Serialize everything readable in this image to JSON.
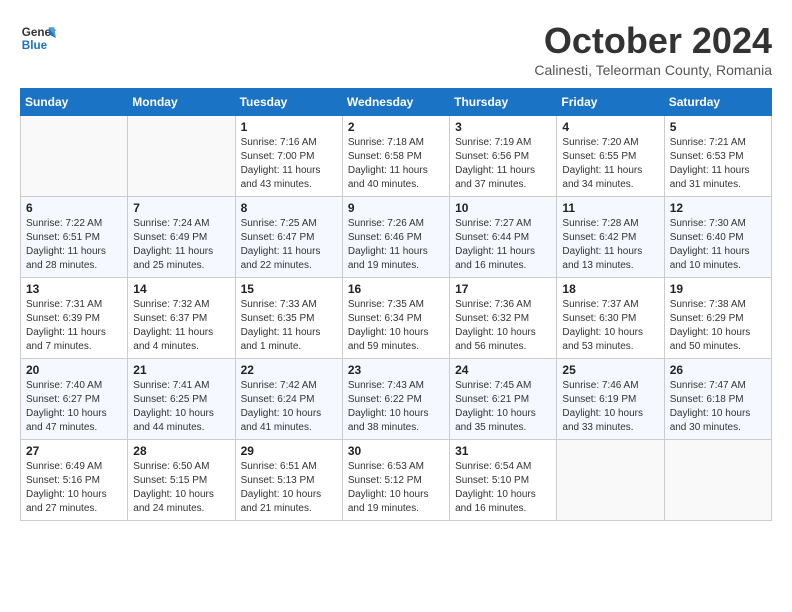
{
  "header": {
    "logo_line1": "General",
    "logo_line2": "Blue",
    "month": "October 2024",
    "location": "Calinesti, Teleorman County, Romania"
  },
  "weekdays": [
    "Sunday",
    "Monday",
    "Tuesday",
    "Wednesday",
    "Thursday",
    "Friday",
    "Saturday"
  ],
  "weeks": [
    [
      {
        "num": "",
        "info": ""
      },
      {
        "num": "",
        "info": ""
      },
      {
        "num": "1",
        "info": "Sunrise: 7:16 AM\nSunset: 7:00 PM\nDaylight: 11 hours\nand 43 minutes."
      },
      {
        "num": "2",
        "info": "Sunrise: 7:18 AM\nSunset: 6:58 PM\nDaylight: 11 hours\nand 40 minutes."
      },
      {
        "num": "3",
        "info": "Sunrise: 7:19 AM\nSunset: 6:56 PM\nDaylight: 11 hours\nand 37 minutes."
      },
      {
        "num": "4",
        "info": "Sunrise: 7:20 AM\nSunset: 6:55 PM\nDaylight: 11 hours\nand 34 minutes."
      },
      {
        "num": "5",
        "info": "Sunrise: 7:21 AM\nSunset: 6:53 PM\nDaylight: 11 hours\nand 31 minutes."
      }
    ],
    [
      {
        "num": "6",
        "info": "Sunrise: 7:22 AM\nSunset: 6:51 PM\nDaylight: 11 hours\nand 28 minutes."
      },
      {
        "num": "7",
        "info": "Sunrise: 7:24 AM\nSunset: 6:49 PM\nDaylight: 11 hours\nand 25 minutes."
      },
      {
        "num": "8",
        "info": "Sunrise: 7:25 AM\nSunset: 6:47 PM\nDaylight: 11 hours\nand 22 minutes."
      },
      {
        "num": "9",
        "info": "Sunrise: 7:26 AM\nSunset: 6:46 PM\nDaylight: 11 hours\nand 19 minutes."
      },
      {
        "num": "10",
        "info": "Sunrise: 7:27 AM\nSunset: 6:44 PM\nDaylight: 11 hours\nand 16 minutes."
      },
      {
        "num": "11",
        "info": "Sunrise: 7:28 AM\nSunset: 6:42 PM\nDaylight: 11 hours\nand 13 minutes."
      },
      {
        "num": "12",
        "info": "Sunrise: 7:30 AM\nSunset: 6:40 PM\nDaylight: 11 hours\nand 10 minutes."
      }
    ],
    [
      {
        "num": "13",
        "info": "Sunrise: 7:31 AM\nSunset: 6:39 PM\nDaylight: 11 hours\nand 7 minutes."
      },
      {
        "num": "14",
        "info": "Sunrise: 7:32 AM\nSunset: 6:37 PM\nDaylight: 11 hours\nand 4 minutes."
      },
      {
        "num": "15",
        "info": "Sunrise: 7:33 AM\nSunset: 6:35 PM\nDaylight: 11 hours\nand 1 minute."
      },
      {
        "num": "16",
        "info": "Sunrise: 7:35 AM\nSunset: 6:34 PM\nDaylight: 10 hours\nand 59 minutes."
      },
      {
        "num": "17",
        "info": "Sunrise: 7:36 AM\nSunset: 6:32 PM\nDaylight: 10 hours\nand 56 minutes."
      },
      {
        "num": "18",
        "info": "Sunrise: 7:37 AM\nSunset: 6:30 PM\nDaylight: 10 hours\nand 53 minutes."
      },
      {
        "num": "19",
        "info": "Sunrise: 7:38 AM\nSunset: 6:29 PM\nDaylight: 10 hours\nand 50 minutes."
      }
    ],
    [
      {
        "num": "20",
        "info": "Sunrise: 7:40 AM\nSunset: 6:27 PM\nDaylight: 10 hours\nand 47 minutes."
      },
      {
        "num": "21",
        "info": "Sunrise: 7:41 AM\nSunset: 6:25 PM\nDaylight: 10 hours\nand 44 minutes."
      },
      {
        "num": "22",
        "info": "Sunrise: 7:42 AM\nSunset: 6:24 PM\nDaylight: 10 hours\nand 41 minutes."
      },
      {
        "num": "23",
        "info": "Sunrise: 7:43 AM\nSunset: 6:22 PM\nDaylight: 10 hours\nand 38 minutes."
      },
      {
        "num": "24",
        "info": "Sunrise: 7:45 AM\nSunset: 6:21 PM\nDaylight: 10 hours\nand 35 minutes."
      },
      {
        "num": "25",
        "info": "Sunrise: 7:46 AM\nSunset: 6:19 PM\nDaylight: 10 hours\nand 33 minutes."
      },
      {
        "num": "26",
        "info": "Sunrise: 7:47 AM\nSunset: 6:18 PM\nDaylight: 10 hours\nand 30 minutes."
      }
    ],
    [
      {
        "num": "27",
        "info": "Sunrise: 6:49 AM\nSunset: 5:16 PM\nDaylight: 10 hours\nand 27 minutes."
      },
      {
        "num": "28",
        "info": "Sunrise: 6:50 AM\nSunset: 5:15 PM\nDaylight: 10 hours\nand 24 minutes."
      },
      {
        "num": "29",
        "info": "Sunrise: 6:51 AM\nSunset: 5:13 PM\nDaylight: 10 hours\nand 21 minutes."
      },
      {
        "num": "30",
        "info": "Sunrise: 6:53 AM\nSunset: 5:12 PM\nDaylight: 10 hours\nand 19 minutes."
      },
      {
        "num": "31",
        "info": "Sunrise: 6:54 AM\nSunset: 5:10 PM\nDaylight: 10 hours\nand 16 minutes."
      },
      {
        "num": "",
        "info": ""
      },
      {
        "num": "",
        "info": ""
      }
    ]
  ]
}
